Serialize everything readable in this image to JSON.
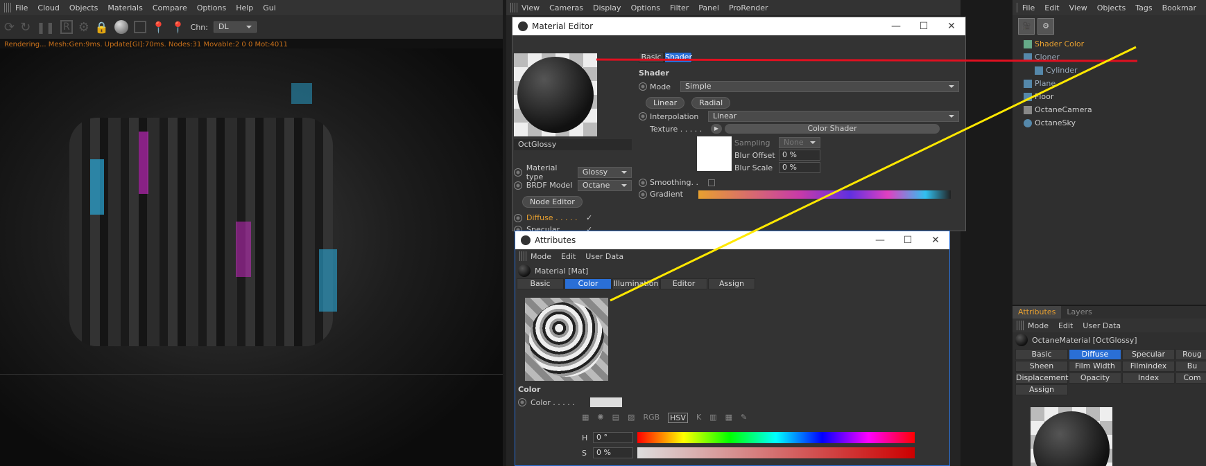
{
  "viewport": {
    "menus": [
      "File",
      "Cloud",
      "Objects",
      "Materials",
      "Compare",
      "Options",
      "Help",
      "Gui"
    ],
    "channel_label": "Chn:",
    "channel_value": "DL",
    "status": "Rendering... Mesh:Gen:9ms. Update[GI]:70ms. Nodes:31 Movable:2  0 0 Mot:4011"
  },
  "panel_menu": [
    "View",
    "Cameras",
    "Display",
    "Options",
    "Filter",
    "Panel",
    "ProRender"
  ],
  "material_editor": {
    "title": "Material Editor",
    "name": "OctGlossy",
    "tabs": [
      "Basic",
      "Shader"
    ],
    "section": "Shader",
    "mode_label": "Mode",
    "mode_value": "Simple",
    "linear_btn": "Linear",
    "radial_btn": "Radial",
    "interp_label": "Interpolation",
    "interp_value": "Linear",
    "texture_label": "Texture . . . . .",
    "texture_btn": "Color Shader",
    "sampling_label": "Sampling",
    "sampling_value": "None",
    "blur_offset_label": "Blur Offset",
    "blur_offset_value": "0 %",
    "blur_scale_label": "Blur Scale",
    "blur_scale_value": "0 %",
    "smoothing_label": "Smoothing. .",
    "gradient_label": "Gradient",
    "mat_type_label": "Material type",
    "mat_type_value": "Glossy",
    "brdf_label": "BRDF Model",
    "brdf_value": "Octane",
    "node_editor_btn": "Node Editor",
    "diffuse_label": "Diffuse . . . . .",
    "specular_label": "Specular"
  },
  "attributes_win": {
    "title": "Attributes",
    "menus": [
      "Mode",
      "Edit",
      "User Data"
    ],
    "material_label": "Material [Mat]",
    "tabs": [
      "Basic",
      "Color",
      "Illumination",
      "Editor",
      "Assign"
    ],
    "section": "Color",
    "color_label": "Color . . . . .",
    "h_label": "H",
    "h_value": "0 °",
    "s_label": "S",
    "s_value": "0 %",
    "modes": [
      "RGB",
      "HSV",
      "K"
    ]
  },
  "objects": {
    "menus": [
      "File",
      "Edit",
      "View",
      "Objects",
      "Tags",
      "Bookmar"
    ],
    "items": [
      {
        "name": "Shader Color",
        "color": "#e8a030"
      },
      {
        "name": "Cloner",
        "color": "#9ab"
      },
      {
        "name": "Cylinder",
        "color": "#9ab"
      },
      {
        "name": "Plane",
        "color": "#9ab"
      },
      {
        "name": "Floor",
        "color": "#ccc"
      },
      {
        "name": "OctaneCamera",
        "color": "#ccc"
      },
      {
        "name": "OctaneSky",
        "color": "#ccc"
      }
    ]
  },
  "right_attributes": {
    "tabs": [
      "Attributes",
      "Layers"
    ],
    "menus": [
      "Mode",
      "Edit",
      "User Data"
    ],
    "material_label": "OctaneMaterial [OctGlossy]",
    "tabs_grid": [
      "Basic",
      "Diffuse",
      "Specular",
      "Roug",
      "Sheen",
      "Film Width",
      "Filmindex",
      "Bu",
      "Displacement",
      "Opacity",
      "Index",
      "Com",
      "Assign"
    ]
  },
  "colors": {
    "accent": "#2a6fd6",
    "orange": "#e8a030"
  }
}
